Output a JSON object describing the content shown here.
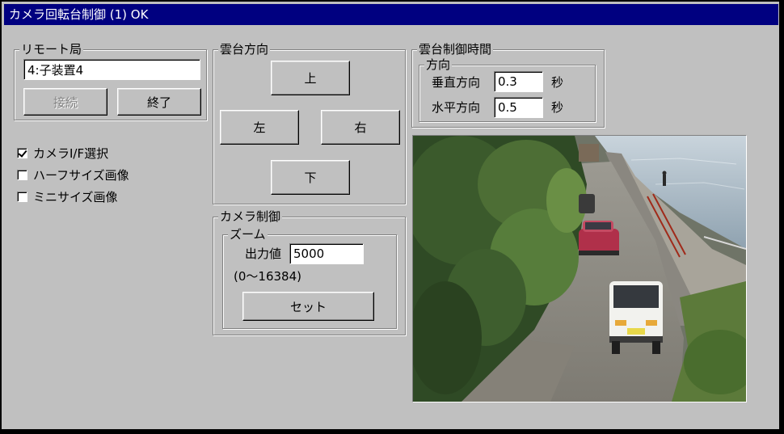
{
  "window": {
    "title": "カメラ回転台制御 (1) OK"
  },
  "remote": {
    "label": "リモート局",
    "station_value": "4:子装置4",
    "connect_label": "接続",
    "exit_label": "終了"
  },
  "options": [
    {
      "label": "カメラI/F選択",
      "checked": true
    },
    {
      "label": "ハーフサイズ画像",
      "checked": false
    },
    {
      "label": "ミニサイズ画像",
      "checked": false
    }
  ],
  "pan_tilt": {
    "label": "雲台方向",
    "up": "上",
    "left": "左",
    "right": "右",
    "down": "下"
  },
  "camera": {
    "label": "カメラ制御",
    "zoom_label": "ズーム",
    "output_label": "出力値",
    "output_value": "5000",
    "range_text": "(0～16384)",
    "set_label": "セット"
  },
  "timing": {
    "label": "雲台制御時間",
    "direction_label": "方向",
    "vertical_label": "垂直方向",
    "vertical_value": "0.3",
    "horizontal_label": "水平方向",
    "horizontal_value": "0.5",
    "unit": "秒"
  },
  "colors": {
    "titlebar": "#000080",
    "face": "#c0c0c0"
  }
}
